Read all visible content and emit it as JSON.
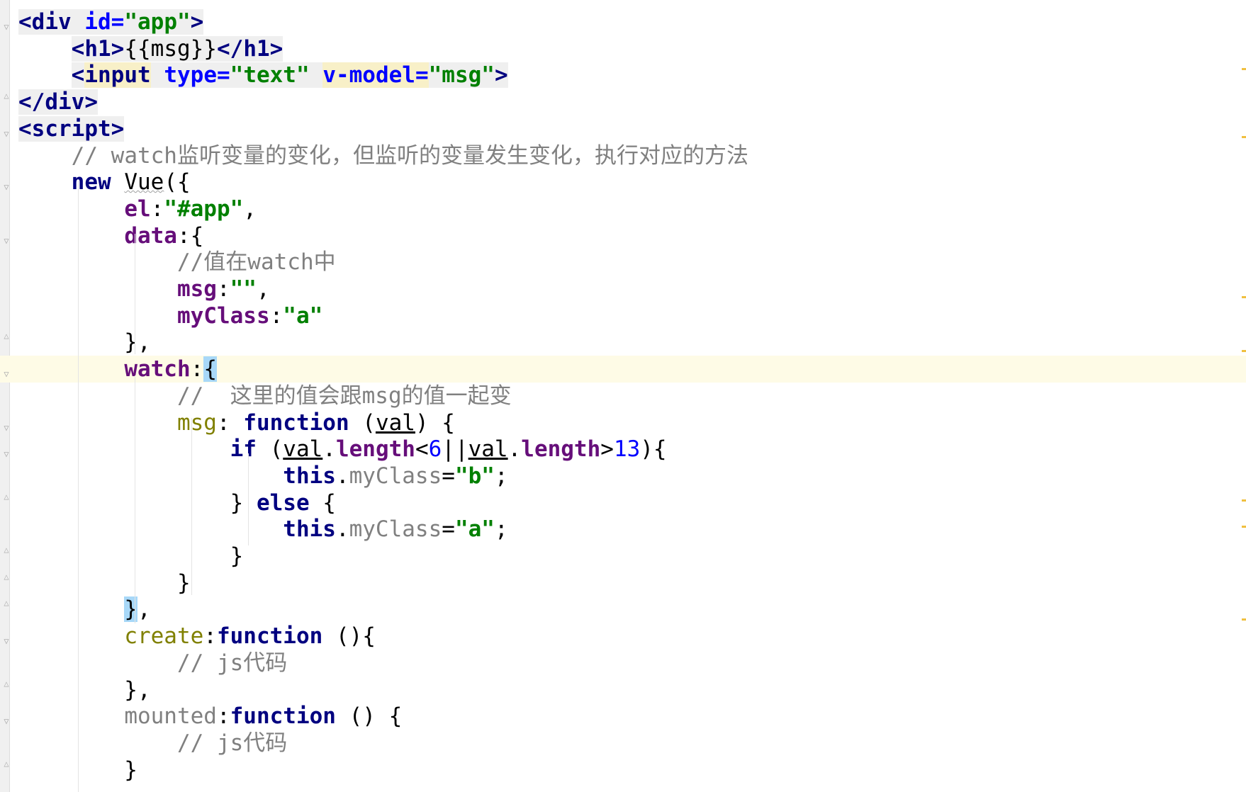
{
  "editor": {
    "lines": [
      {
        "fold": "open",
        "segs": [
          [
            "<",
            "tag tagbg"
          ],
          [
            "div",
            "tag tagbg"
          ],
          [
            " ",
            "tagbg"
          ],
          [
            "id=",
            "attr tagbg"
          ],
          [
            "\"app\"",
            "str tagbg"
          ],
          [
            ">",
            "tag tagbg"
          ]
        ]
      },
      {
        "segs": [
          [
            "    ",
            ""
          ],
          [
            "<",
            "tag tagbg"
          ],
          [
            "h1",
            "tag tagbg"
          ],
          [
            ">",
            "tag tagbg"
          ],
          [
            "{{msg}}",
            "tagbg"
          ],
          [
            "</",
            "tag tagbg"
          ],
          [
            "h1",
            "tag tagbg"
          ],
          [
            ">",
            "tag tagbg"
          ]
        ]
      },
      {
        "segs": [
          [
            "    ",
            ""
          ],
          [
            "<",
            "tag tagbg"
          ],
          [
            "input",
            "tag hl"
          ],
          [
            " ",
            "tagbg"
          ],
          [
            "type=",
            "attr tagbg"
          ],
          [
            "\"text\"",
            "str tagbg"
          ],
          [
            " ",
            "tagbg"
          ],
          [
            "v-model=",
            "attr hl"
          ],
          [
            "\"msg\"",
            "str tagbg"
          ],
          [
            ">",
            "tag tagbg"
          ]
        ]
      },
      {
        "fold": "close",
        "segs": [
          [
            "</",
            "tag tagbg"
          ],
          [
            "div",
            "tag tagbg"
          ],
          [
            ">",
            "tag tagbg"
          ]
        ]
      },
      {
        "fold": "open",
        "segs": [
          [
            "<",
            "tag tagbg"
          ],
          [
            "script",
            "tag tagbg"
          ],
          [
            ">",
            "tag tagbg"
          ]
        ]
      },
      {
        "segs": [
          [
            "    // ",
            "cmt"
          ],
          [
            "watch",
            "cmt it"
          ],
          [
            "监听变量的变化，但监听的变量发生变化，执行对应的方法",
            "cmt"
          ]
        ]
      },
      {
        "fold": "open",
        "segs": [
          [
            "    ",
            ""
          ],
          [
            "new",
            "kw"
          ],
          [
            " ",
            ""
          ],
          [
            "Vue",
            "wavy"
          ],
          [
            "({",
            ""
          ]
        ]
      },
      {
        "segs": [
          [
            "        ",
            ""
          ],
          [
            "el",
            "prop"
          ],
          [
            ":",
            ""
          ],
          [
            "\"#app\"",
            "str"
          ],
          [
            ",",
            ""
          ]
        ]
      },
      {
        "fold": "open",
        "segs": [
          [
            "        ",
            ""
          ],
          [
            "data",
            "prop"
          ],
          [
            ":{",
            ""
          ]
        ]
      },
      {
        "segs": [
          [
            "            //值在",
            "cmt"
          ],
          [
            "watch",
            "cmt it"
          ],
          [
            "中",
            "cmt"
          ]
        ]
      },
      {
        "segs": [
          [
            "            ",
            ""
          ],
          [
            "msg",
            "prop"
          ],
          [
            ":",
            ""
          ],
          [
            "\"\"",
            "str"
          ],
          [
            ",",
            ""
          ]
        ]
      },
      {
        "segs": [
          [
            "            ",
            ""
          ],
          [
            "myClass",
            "prop"
          ],
          [
            ":",
            ""
          ],
          [
            "\"a\"",
            "str"
          ]
        ]
      },
      {
        "fold": "close",
        "segs": [
          [
            "        },",
            ""
          ]
        ]
      },
      {
        "fold": "open",
        "current": true,
        "segs": [
          [
            "        ",
            ""
          ],
          [
            "watch",
            "prop"
          ],
          [
            ":",
            ""
          ],
          [
            "{",
            "brace"
          ]
        ]
      },
      {
        "segs": [
          [
            "            //  这里的值会跟",
            "cmt"
          ],
          [
            "msg",
            "cmt it"
          ],
          [
            "的值一起变",
            "cmt"
          ]
        ]
      },
      {
        "fold": "open",
        "segs": [
          [
            "            ",
            ""
          ],
          [
            "msg",
            "meth"
          ],
          [
            ": ",
            ""
          ],
          [
            "function",
            "kw"
          ],
          [
            " (",
            ""
          ],
          [
            "val",
            "param"
          ],
          [
            ") {",
            ""
          ]
        ]
      },
      {
        "fold": "open",
        "segs": [
          [
            "                ",
            ""
          ],
          [
            "if",
            "kw"
          ],
          [
            " (",
            ""
          ],
          [
            "val",
            "param"
          ],
          [
            ".",
            ""
          ],
          [
            "length",
            "prop"
          ],
          [
            "<",
            ""
          ],
          [
            "6",
            "num"
          ],
          [
            "||",
            ""
          ],
          [
            "val",
            "param"
          ],
          [
            ".",
            ""
          ],
          [
            "length",
            "prop"
          ],
          [
            ">",
            ""
          ],
          [
            "13",
            "num"
          ],
          [
            "){",
            ""
          ]
        ]
      },
      {
        "segs": [
          [
            "                    ",
            ""
          ],
          [
            "this",
            "kw"
          ],
          [
            ".",
            ""
          ],
          [
            "myClass",
            "unused"
          ],
          [
            "=",
            ""
          ],
          [
            "\"b\"",
            "str"
          ],
          [
            ";",
            ""
          ]
        ]
      },
      {
        "fold": "close",
        "segs": [
          [
            "                } ",
            ""
          ],
          [
            "else",
            "kw"
          ],
          [
            " {",
            ""
          ]
        ]
      },
      {
        "segs": [
          [
            "                    ",
            ""
          ],
          [
            "this",
            "kw"
          ],
          [
            ".",
            ""
          ],
          [
            "myClass",
            "unused"
          ],
          [
            "=",
            ""
          ],
          [
            "\"a\"",
            "str"
          ],
          [
            ";",
            ""
          ]
        ]
      },
      {
        "fold": "close",
        "segs": [
          [
            "                }",
            ""
          ]
        ]
      },
      {
        "fold": "close",
        "segs": [
          [
            "            }",
            ""
          ]
        ]
      },
      {
        "fold": "close",
        "segs": [
          [
            "        ",
            ""
          ],
          [
            "}",
            "brace"
          ],
          [
            ",",
            ""
          ]
        ]
      },
      {
        "fold": "open",
        "segs": [
          [
            "        ",
            ""
          ],
          [
            "create",
            "meth"
          ],
          [
            ":",
            ""
          ],
          [
            "function",
            "kw"
          ],
          [
            " (){",
            ""
          ]
        ]
      },
      {
        "segs": [
          [
            "            // ",
            "cmt"
          ],
          [
            "js",
            "cmt it"
          ],
          [
            "代码",
            "cmt"
          ]
        ]
      },
      {
        "fold": "close",
        "segs": [
          [
            "        },",
            ""
          ]
        ]
      },
      {
        "fold": "open",
        "segs": [
          [
            "        ",
            ""
          ],
          [
            "mounted",
            "unused"
          ],
          [
            ":",
            ""
          ],
          [
            "function",
            "kw"
          ],
          [
            " () {",
            ""
          ]
        ]
      },
      {
        "segs": [
          [
            "            // ",
            "cmt"
          ],
          [
            "js",
            "cmt it"
          ],
          [
            "代码",
            "cmt"
          ]
        ]
      },
      {
        "fold": "close",
        "segs": [
          [
            "        }",
            ""
          ]
        ]
      }
    ]
  },
  "colors": {
    "tag": "#000080",
    "attribute": "#0000ff",
    "string": "#008000",
    "keyword": "#000080",
    "property": "#660e7a",
    "comment": "#808080",
    "number": "#0000ff",
    "current_line": "#fefbe6",
    "brace_match": "#a8d8f8"
  }
}
